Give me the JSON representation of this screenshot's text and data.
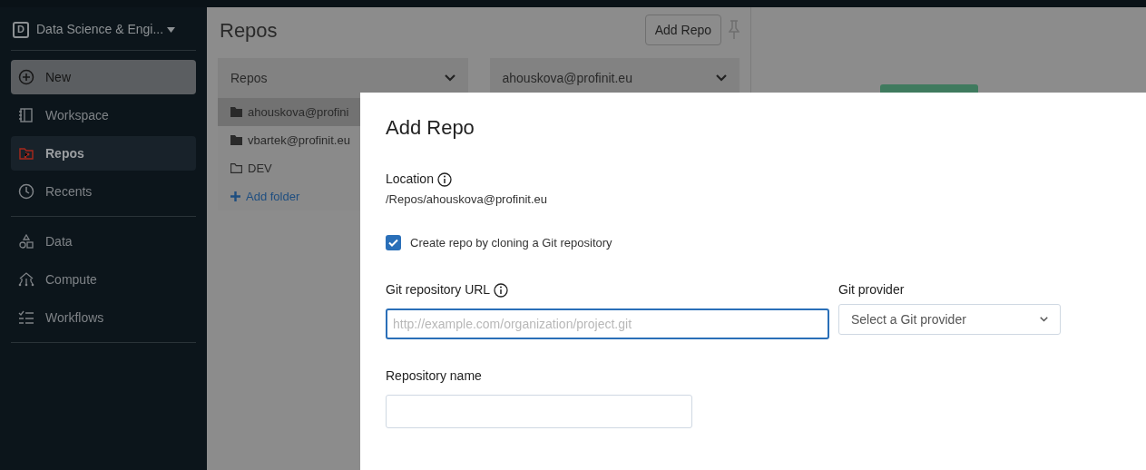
{
  "workspace": {
    "badge": "D",
    "name": "Data Science & Engi..."
  },
  "sidebar": {
    "items": [
      {
        "label": "New",
        "kind": "new",
        "selected": false
      },
      {
        "label": "Workspace",
        "kind": "workspace",
        "selected": false
      },
      {
        "label": "Repos",
        "kind": "repos",
        "selected": true
      },
      {
        "label": "Recents",
        "kind": "recents",
        "selected": false
      },
      {
        "label": "Data",
        "kind": "data",
        "selected": false
      },
      {
        "label": "Compute",
        "kind": "compute",
        "selected": false
      },
      {
        "label": "Workflows",
        "kind": "workflows",
        "selected": false
      }
    ]
  },
  "repos_panel": {
    "title": "Repos",
    "add_button": "Add Repo",
    "column_1": {
      "header": "Repos",
      "items": [
        {
          "label": "ahouskova@profini",
          "kind": "user",
          "selected": true
        },
        {
          "label": "vbartek@profinit.eu",
          "kind": "user",
          "selected": false
        },
        {
          "label": "DEV",
          "kind": "folder",
          "selected": false
        },
        {
          "label": "Add folder",
          "kind": "add",
          "selected": false
        }
      ]
    },
    "column_2": {
      "header": "ahouskova@profinit.eu"
    }
  },
  "dialog": {
    "title": "Add Repo",
    "location_label": "Location",
    "location_value": "/Repos/ahouskova@profinit.eu",
    "clone_checkbox": {
      "label": "Create repo by cloning a Git repository",
      "checked": true
    },
    "url_field": {
      "label": "Git repository URL",
      "placeholder": "http://example.com/organization/project.git"
    },
    "provider_field": {
      "label": "Git provider",
      "placeholder": "Select a Git provider"
    },
    "name_field": {
      "label": "Repository name"
    }
  }
}
